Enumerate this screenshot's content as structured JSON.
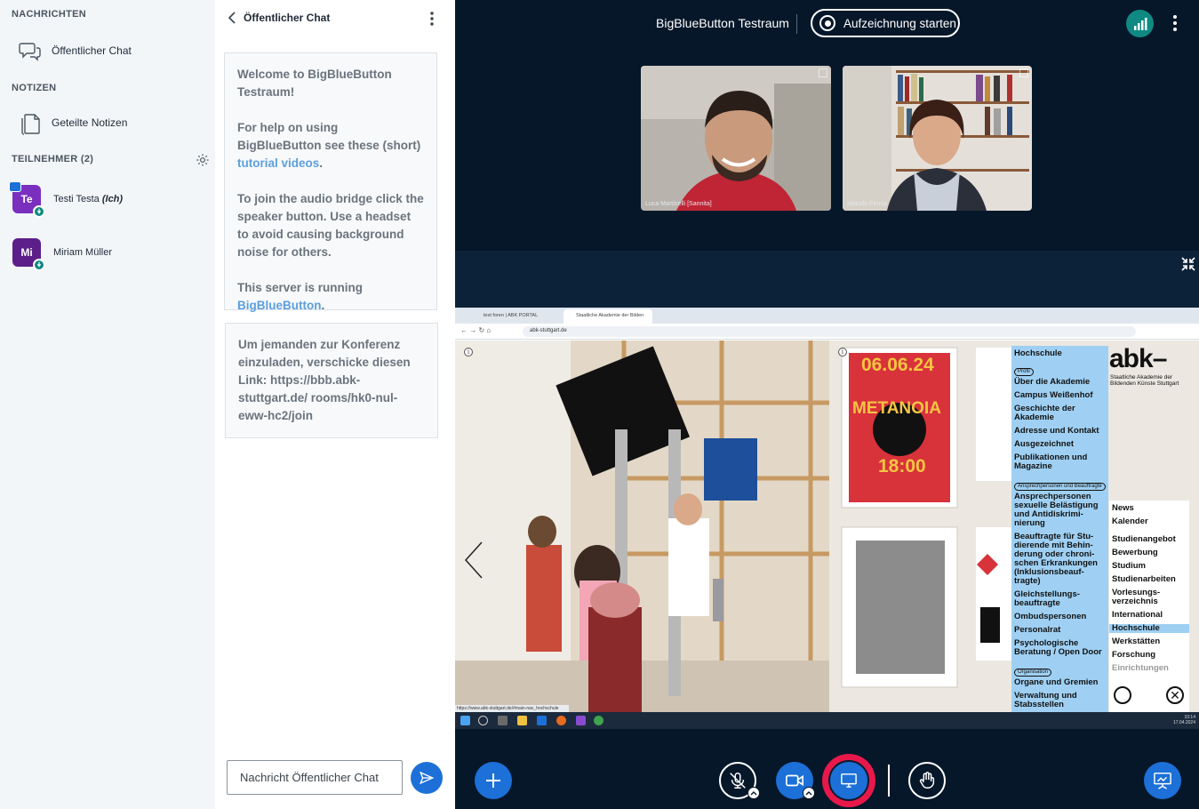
{
  "sidebar": {
    "messages_title": "NACHRICHTEN",
    "public_chat_label": "Öffentlicher Chat",
    "notes_title": "NOTIZEN",
    "shared_notes_label": "Geteilte Notizen",
    "participants_title": "TEILNEHMER (2)",
    "users": [
      {
        "initials": "Te",
        "name": "Testi Testa",
        "suffix": "(Ich)",
        "color": "#7b2fbf"
      },
      {
        "initials": "Mi",
        "name": "Miriam Müller",
        "suffix": "",
        "color": "#5c1f8a"
      }
    ]
  },
  "chat": {
    "title": "Öffentlicher Chat",
    "welcome": {
      "line1": "Welcome to BigBlueButton Testraum!",
      "line2_pre": "For help on using BigBlueButton see these (short)",
      "line2_link": "tutorial videos",
      "line2_post": ".",
      "line3": "To join the audio bridge click the speaker button. Use a headset to avoid causing background noise for others.",
      "line4_pre": "This server is running",
      "line4_link": "BigBlueButton",
      "line4_post": "."
    },
    "invite": "Um jemanden zur Konferenz einzuladen, verschicke diesen Link: https://bbb.abk-stuttgart.de/ rooms/hk0-nul-eww-hc2/join",
    "input_placeholder": "Nachricht Öffentlicher Chat"
  },
  "topbar": {
    "room_title": "BigBlueButton Testraum",
    "record_label": "Aufzeichnung starten"
  },
  "videos": [
    {
      "name": "Luca Martinelli [Sannita]"
    },
    {
      "name": "Iolanda Pensa"
    }
  ],
  "presentation": {
    "tabs": [
      "test foren | ABK PORTAL",
      "Staatliche Akademie der Bilden"
    ],
    "url": "abk-stuttgart.de",
    "site": {
      "logo": "abk–",
      "logo_sub": "Staatliche Akademie der Bildenden Künste Stuttgart",
      "menu_title": "Hochschule",
      "tag_profil": "Profil",
      "left_items_a": [
        "Über die Akademie",
        "Campus Weißenhof",
        "Geschichte der Akademie",
        "Adresse und Kontakt",
        "Ausgezeichnet",
        "Publikationen und Magazine"
      ],
      "tag_ansprech": "Ansprechpersonen und Beauftragte",
      "left_items_b": [
        "Ansprechpersonen sexuelle Belästigung und Antidiskrimi-nierung",
        "Beauftragte für Stu-dierende mit Behin-derung oder chroni-schen Erkrankungen (Inklusionsbeauf-tragte)",
        "Gleichstellungs-beauftragte",
        "Ombudspersonen",
        "Personalrat",
        "Psychologische Beratung / Open Door"
      ],
      "tag_organisation": "Organisation",
      "left_items_c": [
        "Organe und Gremien",
        "Verwaltung und Stabsstellen"
      ],
      "right_items": [
        "News",
        "Kalender",
        "Studienangebot",
        "Bewerbung",
        "Studium",
        "Studienarbeiten",
        "Vorlesungs-verzeichnis",
        "International",
        "Hochschule",
        "Werkstätten",
        "Forschung",
        "Einrichtungen"
      ],
      "poster_date": "06.06.24",
      "poster_title": "METANOIA",
      "poster_time": "18:00"
    },
    "status_link": "https://www.abk-stuttgart.de/#main-nav_hochschule",
    "clock": "10:14",
    "date": "17.04.2024"
  },
  "colors": {
    "accent": "#1c70d7",
    "main_bg": "#06172a",
    "share_active": "#e8194a",
    "connection_ok": "#0f8a83"
  }
}
